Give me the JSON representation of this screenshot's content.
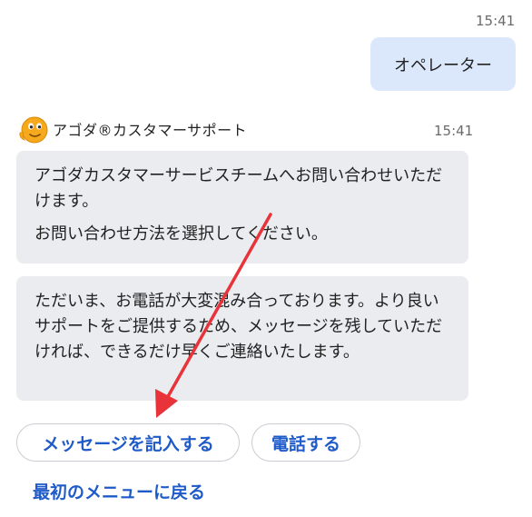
{
  "user_message": {
    "time": "15:41",
    "text": "オペレーター"
  },
  "bot": {
    "name": "アゴダ®カスタマーサポート",
    "time": "15:41",
    "avatar_icon": "agoda-mascot-icon",
    "bubble1": {
      "line1": "アゴダカスタマーサービスチームへお問い合わせいただけます。",
      "line2": "お問い合わせ方法を選択してください。"
    },
    "bubble2": {
      "text": "ただいま、お電話が大変混み合っております。より良いサポートをご提供するため、メッセージを残していただければ、できるだけ早くご連絡いたします。"
    }
  },
  "actions": {
    "message_label": "メッセージを記入する",
    "phone_label": "電話する",
    "back_label": "最初のメニューに戻る"
  },
  "colors": {
    "user_bubble": "#dbe8fb",
    "bot_bubble": "#ebecef",
    "link_blue": "#1f5bc8",
    "annotation_arrow": "#e8333a",
    "avatar_orange": "#f5a623"
  }
}
